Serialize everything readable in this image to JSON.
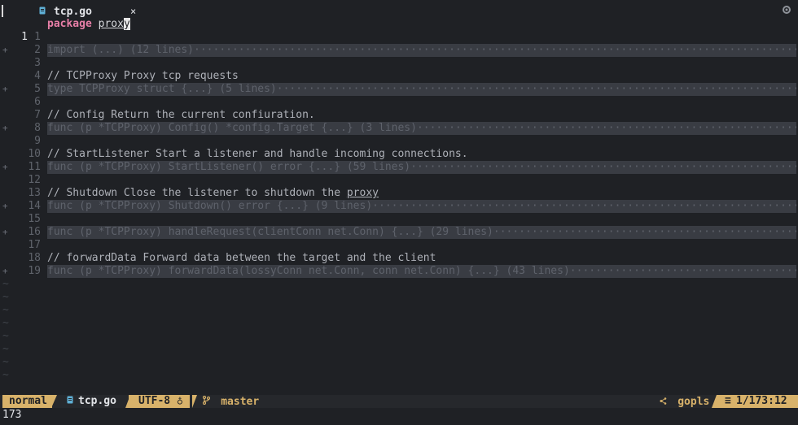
{
  "tab": {
    "filename": "tcp.go",
    "close_glyph": "×",
    "file_icon": "file-icon",
    "settings_icon": "gear-icon"
  },
  "editor": {
    "current_line": "1",
    "line1": {
      "num": "1",
      "keyword": "package",
      "name_before_cursor": "prox",
      "cursor_char": "y"
    },
    "lines": [
      {
        "num": "1",
        "type": "blank",
        "text": ""
      },
      {
        "num": "2",
        "type": "fold",
        "text": "import (...) (12 lines)"
      },
      {
        "num": "3",
        "type": "blank",
        "text": ""
      },
      {
        "num": "4",
        "type": "comment",
        "text": "// TCPProxy Proxy tcp requests"
      },
      {
        "num": "5",
        "type": "fold",
        "text": "type TCPProxy struct {...} (5 lines)"
      },
      {
        "num": "6",
        "type": "blank",
        "text": ""
      },
      {
        "num": "7",
        "type": "comment",
        "text": "// Config Return the current confiuration."
      },
      {
        "num": "8",
        "type": "fold",
        "text": "func (p *TCPProxy) Config() *config.Target {...} (3 lines)"
      },
      {
        "num": "9",
        "type": "blank",
        "text": ""
      },
      {
        "num": "10",
        "type": "comment",
        "text": "// StartListener Start a listener and handle incoming connections."
      },
      {
        "num": "11",
        "type": "fold",
        "text": "func (p *TCPProxy) StartListener() error {...} (59 lines)"
      },
      {
        "num": "12",
        "type": "blank",
        "text": ""
      },
      {
        "num": "13",
        "type": "comment-underline",
        "text": "// Shutdown Close the listener to shutdown the ",
        "underlined": "proxy"
      },
      {
        "num": "14",
        "type": "fold",
        "text": "func (p *TCPProxy) Shutdown() error {...} (9 lines)"
      },
      {
        "num": "15",
        "type": "blank",
        "text": ""
      },
      {
        "num": "16",
        "type": "fold",
        "text": "func (p *TCPProxy) handleRequest(clientConn net.Conn) {...} (29 lines)"
      },
      {
        "num": "17",
        "type": "blank",
        "text": ""
      },
      {
        "num": "18",
        "type": "comment",
        "text": "// forwardData Forward data between the target and the client"
      },
      {
        "num": "19",
        "type": "fold",
        "text": "func (p *TCPProxy) forwardData(lossyConn net.Conn, conn net.Conn) {...} (43 lines)"
      }
    ],
    "fold_sign": "+",
    "tilde": "~"
  },
  "statusline": {
    "mode": "normal",
    "filename": "tcp.go",
    "encoding": "UTF-8",
    "os_glyph": "♁",
    "branch": "master",
    "branch_icon": "git-branch-icon",
    "lsp": "gopls",
    "position": "1/173:12"
  },
  "cmdline": {
    "text": "173"
  },
  "colors": {
    "background": "#1f2125",
    "fold_bg": "#393c43",
    "accent": "#d8b26a",
    "keyword": "#e77fa7",
    "file_icon": "#5fb0d6"
  }
}
